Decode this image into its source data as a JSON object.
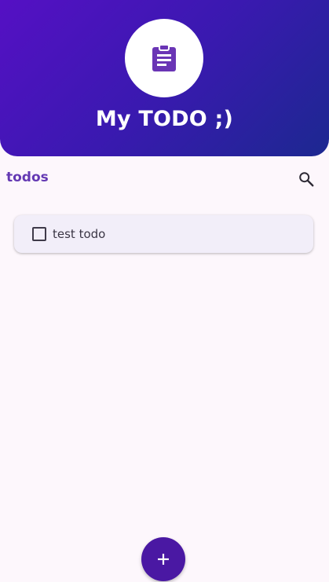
{
  "header": {
    "title": "My TODO ;)",
    "logo_icon": "clipboard-text-icon"
  },
  "section": {
    "title": "todos",
    "search_icon": "search-icon"
  },
  "todos": [
    {
      "text": "test todo",
      "checked": false
    }
  ],
  "fab": {
    "icon": "plus-icon"
  },
  "colors": {
    "accent": "#6439b3",
    "fab": "#4a18a3",
    "header_gradient_start": "#5510c4",
    "header_gradient_end": "#1c2890",
    "card_bg": "#f2eef9",
    "page_bg": "#fdf7fc"
  }
}
